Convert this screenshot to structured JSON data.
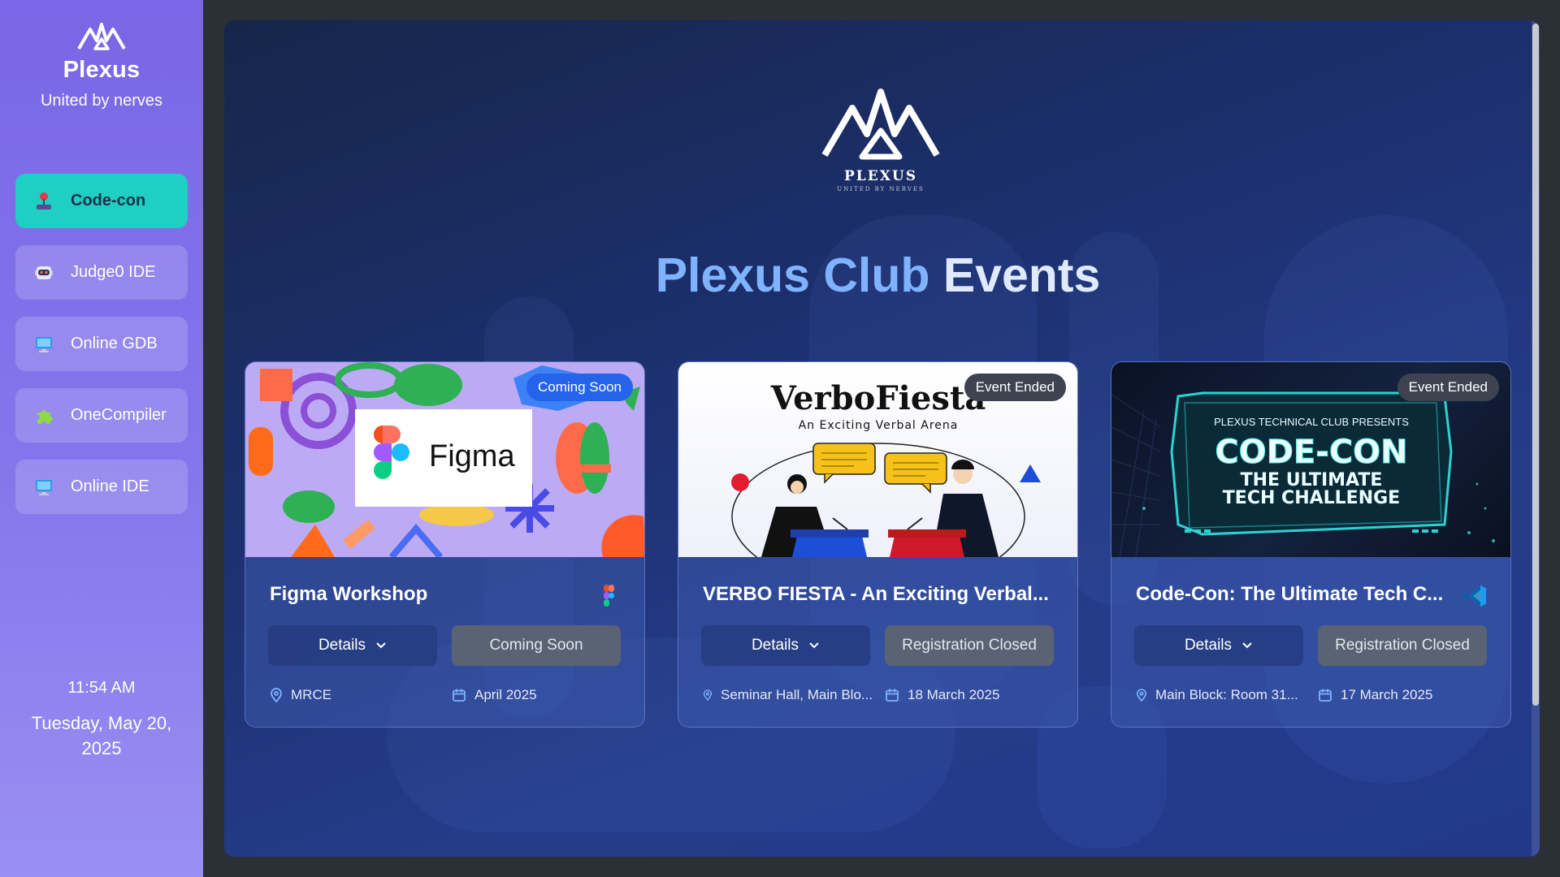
{
  "sidebar": {
    "brand_name": "Plexus",
    "brand_tagline": "United by nerves",
    "items": [
      {
        "label": "Code-con",
        "icon": "joystick-icon",
        "active": true
      },
      {
        "label": "Judge0 IDE",
        "icon": "robot-icon",
        "active": false
      },
      {
        "label": "Online GDB",
        "icon": "monitor-icon",
        "active": false
      },
      {
        "label": "OneCompiler",
        "icon": "puzzle-icon",
        "active": false
      },
      {
        "label": "Online IDE",
        "icon": "monitor-icon",
        "active": false
      }
    ],
    "time": "11:54 AM",
    "date": "Tuesday, May 20, 2025"
  },
  "main": {
    "logo_name": "PLEXUS",
    "logo_tagline": "UNITED BY NERVES",
    "title_part1": "Plexus Club",
    "title_part2": "Events",
    "cards": [
      {
        "badge": "Coming Soon",
        "image_text": "Figma",
        "title": "Figma Workshop",
        "logo": "figma-icon",
        "details_label": "Details",
        "status_label": "Coming Soon",
        "location": "MRCE",
        "date": "April 2025"
      },
      {
        "badge": "Event Ended",
        "image_title": "VerboFiesta",
        "image_subtitle": "An Exciting Verbal Arena",
        "title": "VERBO FIESTA - An Exciting Verbal...",
        "logo": "",
        "details_label": "Details",
        "status_label": "Registration Closed",
        "location": "Seminar Hall, Main Blo...",
        "date": "18 March 2025"
      },
      {
        "badge": "Event Ended",
        "image_kicker": "PLEXUS TECHNICAL CLUB PRESENTS",
        "image_title": "CODE-CON",
        "image_subtitle_1": "THE ULTIMATE",
        "image_subtitle_2": "TECH CHALLENGE",
        "title": "Code-Con: The Ultimate Tech C...",
        "logo": "vscode-icon",
        "details_label": "Details",
        "status_label": "Registration Closed",
        "location": "Main Block: Room 31...",
        "date": "17 March 2025"
      }
    ]
  },
  "colors": {
    "sidebar_top": "#7a66e6",
    "active_item": "#1fcfc3",
    "title_accent": "#7fb3ff",
    "badge_soon": "#2563eb",
    "badge_ended": "#3d4350"
  }
}
